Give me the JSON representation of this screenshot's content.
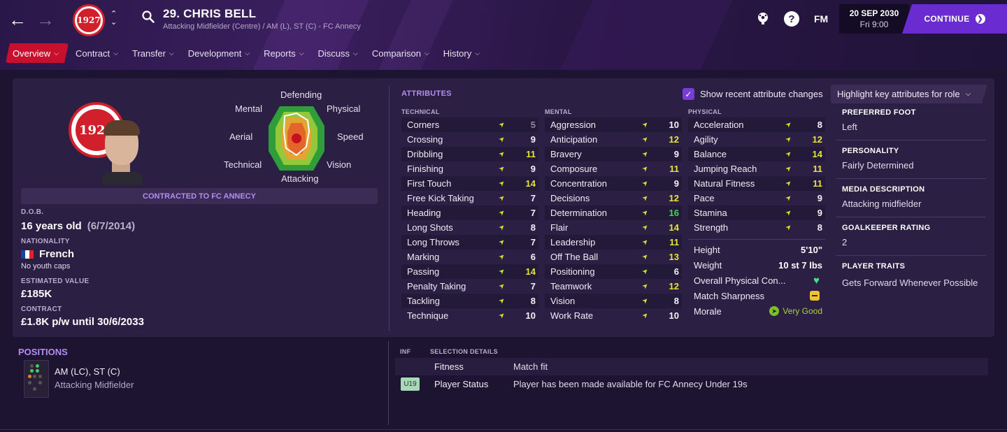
{
  "header": {
    "player_title": "29. CHRIS BELL",
    "subtitle": "Attacking Midfielder (Centre) / AM (L), ST (C) - FC Annecy",
    "club_badge_text": "1927",
    "date": "20 SEP 2030",
    "time": "Fri 9:00",
    "fm_label": "FM",
    "continue_label": "CONTINUE"
  },
  "tabs": [
    {
      "label": "Overview"
    },
    {
      "label": "Contract"
    },
    {
      "label": "Transfer"
    },
    {
      "label": "Development"
    },
    {
      "label": "Reports"
    },
    {
      "label": "Discuss"
    },
    {
      "label": "Comparison"
    },
    {
      "label": "History"
    }
  ],
  "profile": {
    "contract_banner": "CONTRACTED TO FC ANNECY",
    "dob_label": "D.O.B.",
    "age": "16 years old",
    "dob": "(6/7/2014)",
    "nationality_label": "NATIONALITY",
    "nationality": "French",
    "youth_caps": "No youth caps",
    "value_label": "ESTIMATED VALUE",
    "value": "£185K",
    "contract_label": "CONTRACT",
    "contract": "£1.8K p/w until 30/6/2033"
  },
  "radar": {
    "labels": {
      "defending": "Defending",
      "physical": "Physical",
      "speed": "Speed",
      "vision": "Vision",
      "attacking": "Attacking",
      "technical": "Technical",
      "aerial": "Aerial",
      "mental": "Mental"
    }
  },
  "attributes": {
    "title": "ATTRIBUTES",
    "show_changes_label": "Show recent attribute changes",
    "highlight_label": "Highlight key attributes for role",
    "technical_head": "TECHNICAL",
    "mental_head": "MENTAL",
    "physical_head": "PHYSICAL",
    "technical": [
      {
        "name": "Corners",
        "value": "5"
      },
      {
        "name": "Crossing",
        "value": "9"
      },
      {
        "name": "Dribbling",
        "value": "11"
      },
      {
        "name": "Finishing",
        "value": "9"
      },
      {
        "name": "First Touch",
        "value": "14"
      },
      {
        "name": "Free Kick Taking",
        "value": "7"
      },
      {
        "name": "Heading",
        "value": "7"
      },
      {
        "name": "Long Shots",
        "value": "8"
      },
      {
        "name": "Long Throws",
        "value": "7"
      },
      {
        "name": "Marking",
        "value": "6"
      },
      {
        "name": "Passing",
        "value": "14"
      },
      {
        "name": "Penalty Taking",
        "value": "7"
      },
      {
        "name": "Tackling",
        "value": "8"
      },
      {
        "name": "Technique",
        "value": "10"
      }
    ],
    "mental": [
      {
        "name": "Aggression",
        "value": "10"
      },
      {
        "name": "Anticipation",
        "value": "12"
      },
      {
        "name": "Bravery",
        "value": "9"
      },
      {
        "name": "Composure",
        "value": "11"
      },
      {
        "name": "Concentration",
        "value": "9"
      },
      {
        "name": "Decisions",
        "value": "12"
      },
      {
        "name": "Determination",
        "value": "16"
      },
      {
        "name": "Flair",
        "value": "14"
      },
      {
        "name": "Leadership",
        "value": "11"
      },
      {
        "name": "Off The Ball",
        "value": "13"
      },
      {
        "name": "Positioning",
        "value": "6"
      },
      {
        "name": "Teamwork",
        "value": "12"
      },
      {
        "name": "Vision",
        "value": "8"
      },
      {
        "name": "Work Rate",
        "value": "10"
      }
    ],
    "physical": [
      {
        "name": "Acceleration",
        "value": "8"
      },
      {
        "name": "Agility",
        "value": "12"
      },
      {
        "name": "Balance",
        "value": "14"
      },
      {
        "name": "Jumping Reach",
        "value": "11"
      },
      {
        "name": "Natural Fitness",
        "value": "11"
      },
      {
        "name": "Pace",
        "value": "9"
      },
      {
        "name": "Stamina",
        "value": "9"
      },
      {
        "name": "Strength",
        "value": "8"
      }
    ],
    "physical_extra": {
      "height_label": "Height",
      "height": "5'10\"",
      "weight_label": "Weight",
      "weight": "10 st 7 lbs",
      "condition_label": "Overall Physical Con...",
      "sharpness_label": "Match Sharpness",
      "morale_label": "Morale",
      "morale": "Very Good"
    }
  },
  "side_info": {
    "foot_label": "PREFERRED FOOT",
    "foot": "Left",
    "personality_label": "PERSONALITY",
    "personality": "Fairly Determined",
    "media_label": "MEDIA DESCRIPTION",
    "media": "Attacking midfielder",
    "gk_label": "GOALKEEPER RATING",
    "gk": "2",
    "traits_label": "PLAYER TRAITS",
    "traits": "Gets Forward Whenever Possible"
  },
  "positions": {
    "title": "POSITIONS",
    "main": "AM (LC), ST (C)",
    "role": "Attacking Midfielder"
  },
  "selection": {
    "inf_head": "INF",
    "details_head": "SELECTION DETAILS",
    "rows": [
      {
        "badge": "",
        "label": "Fitness",
        "detail": "Match fit"
      },
      {
        "badge": "U19",
        "label": "Player Status",
        "detail": "Player has been made available for FC Annecy Under 19s"
      }
    ]
  },
  "colors": {
    "accent_red": "#c8102e",
    "continue_purple": "#6a2bd1",
    "attr_good": "#e6e63a",
    "attr_great": "#46d35a"
  }
}
